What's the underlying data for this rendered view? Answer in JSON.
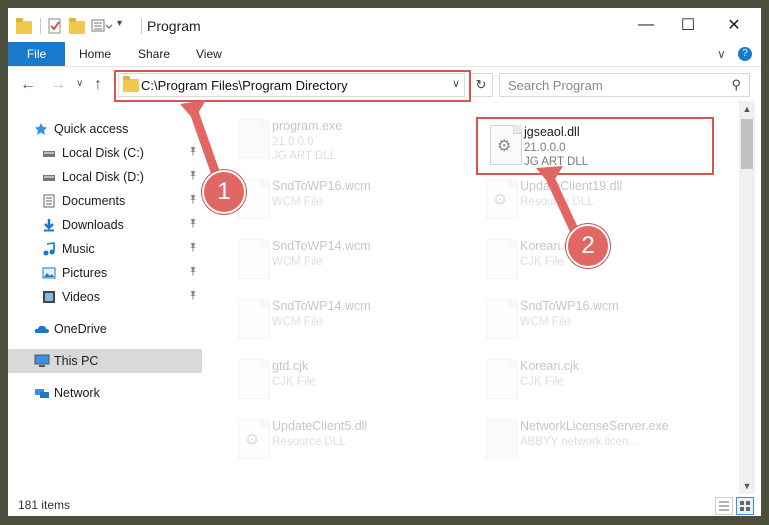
{
  "window": {
    "title": "Program",
    "minimize_glyph": "—",
    "maximize_glyph": "☐",
    "close_glyph": "✕"
  },
  "ribbon": {
    "tabs": [
      "File",
      "Home",
      "Share",
      "View"
    ],
    "expand_glyph": "∨",
    "help_glyph": "?"
  },
  "navigation": {
    "back_glyph": "←",
    "forward_glyph": "→",
    "dropdown_glyph": "∨",
    "up_glyph": "↑"
  },
  "address": {
    "path": "C:\\Program Files\\Program Directory",
    "chevron_glyph": "∨",
    "refresh_glyph": "↻"
  },
  "search": {
    "placeholder": "Search Program",
    "icon_glyph": "⚲"
  },
  "sidebar": {
    "items": [
      {
        "label": "Quick access",
        "icon": "star-icon",
        "pinned": false
      },
      {
        "label": "Local Disk (C:)",
        "icon": "drive-icon",
        "pinned": true
      },
      {
        "label": "Local Disk (D:)",
        "icon": "drive-icon",
        "pinned": true
      },
      {
        "label": "Documents",
        "icon": "documents-icon",
        "pinned": true
      },
      {
        "label": "Downloads",
        "icon": "download-icon",
        "pinned": true
      },
      {
        "label": "Music",
        "icon": "music-icon",
        "pinned": true
      },
      {
        "label": "Pictures",
        "icon": "pictures-icon",
        "pinned": true
      },
      {
        "label": "Videos",
        "icon": "videos-icon",
        "pinned": true
      },
      {
        "label": "OneDrive",
        "icon": "cloud-icon",
        "pinned": false
      },
      {
        "label": "This PC",
        "icon": "computer-icon",
        "pinned": false,
        "selected": true
      },
      {
        "label": "Network",
        "icon": "network-icon",
        "pinned": false
      }
    ],
    "pin_glyph": "📌"
  },
  "files": [
    {
      "name": "program.exe",
      "type": "21.0.0.0",
      "desc": "JG ART DLL",
      "kind": "exe",
      "faded": true
    },
    {
      "name": "jgseaol.dll",
      "type": "21.0.0.0",
      "desc": "JG ART DLL",
      "kind": "gear",
      "faded": false,
      "highlighted": true
    },
    {
      "name": "SndToWP16.wcm",
      "type": "WCM File",
      "kind": "blank",
      "faded": true
    },
    {
      "name": "UpdateClient19.dll",
      "type": "Resource DLL",
      "kind": "gear",
      "faded": true
    },
    {
      "name": "SndToWP14.wcm",
      "type": "WCM File",
      "kind": "blank",
      "faded": true
    },
    {
      "name": "Korean.cjk",
      "type": "CJK File",
      "kind": "blank",
      "faded": true
    },
    {
      "name": "SndToWP14.wcm",
      "type": "WCM File",
      "kind": "blank",
      "faded": true
    },
    {
      "name": "SndToWP16.wcm",
      "type": "WCM File",
      "kind": "blank",
      "faded": true
    },
    {
      "name": "gtd.cjk",
      "type": "CJK File",
      "kind": "blank",
      "faded": true
    },
    {
      "name": "Korean.cjk",
      "type": "CJK File",
      "kind": "blank",
      "faded": true
    },
    {
      "name": "UpdateClient5.dll",
      "type": "Resource DLL",
      "kind": "gear",
      "faded": true
    },
    {
      "name": "NetworkLicenseServer.exe",
      "type": "ABBYY network licen...",
      "kind": "exe",
      "faded": true
    }
  ],
  "annotations": {
    "badge1": "1",
    "badge2": "2",
    "accent_color": "#d9534f"
  },
  "status": {
    "count_text": "181 items"
  },
  "scrollbar": {
    "up_glyph": "▲",
    "down_glyph": "▼"
  }
}
